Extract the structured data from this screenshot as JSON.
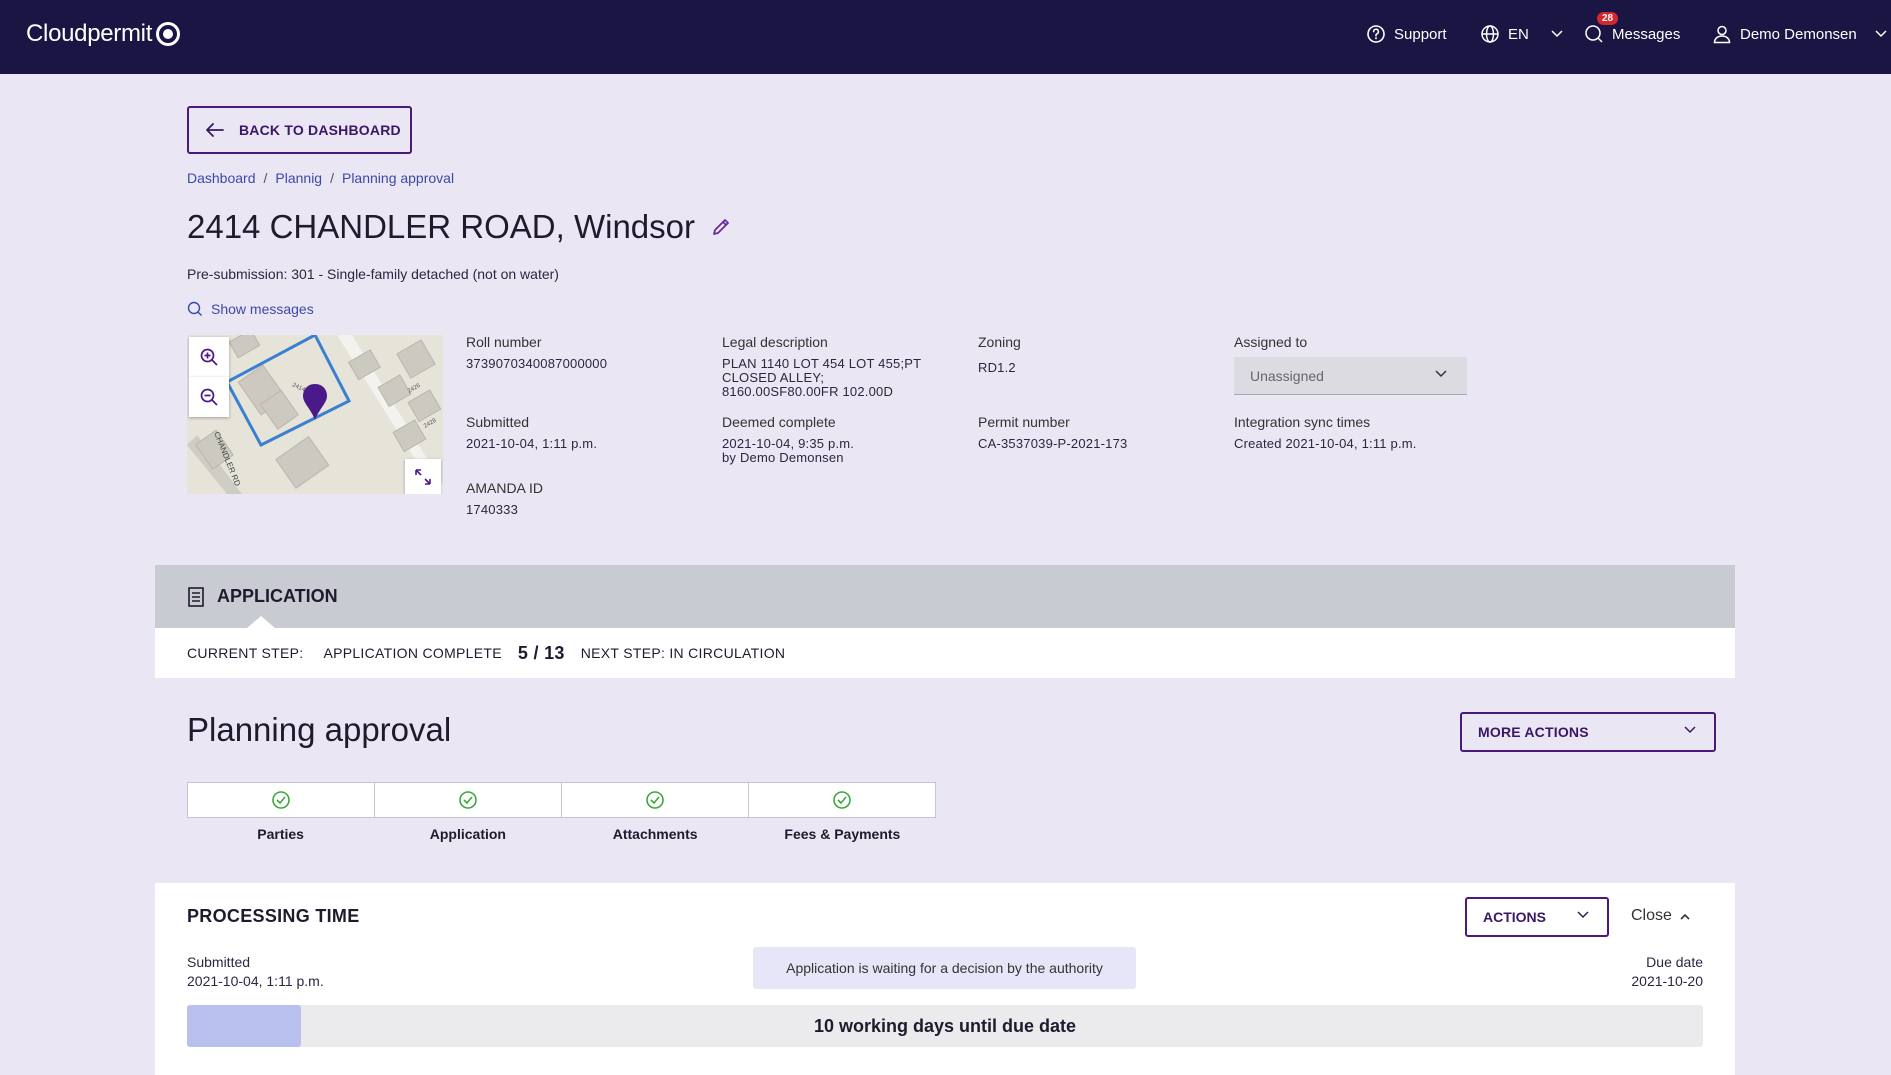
{
  "topbar": {
    "logo_text": "Cloudpermit",
    "support_label": "Support",
    "language_label": "EN",
    "messages_label": "Messages",
    "messages_count": "28",
    "user_name": "Demo Demonsen"
  },
  "back_button": {
    "label": "BACK TO DASHBOARD"
  },
  "breadcrumb": {
    "items": [
      "Dashboard",
      "Plannig",
      "Planning approval"
    ],
    "separator": "/"
  },
  "page": {
    "title": "2414 CHANDLER ROAD, Windsor",
    "subtitle": "Pre-submission: 301 - Single-family detached (not on water)",
    "show_messages": "Show messages"
  },
  "map": {
    "street_label": "CHANDLER RD",
    "house_numbers": [
      "2414",
      "2426",
      "2428"
    ]
  },
  "details": {
    "roll_number": {
      "label": "Roll number",
      "value": "3739070340087000000"
    },
    "legal_description": {
      "label": "Legal description",
      "lines": [
        "PLAN 1140 LOT 454 LOT 455;PT",
        "CLOSED ALLEY;",
        "8160.00SF80.00FR 102.00D"
      ]
    },
    "zoning": {
      "label": "Zoning",
      "value": "RD1.2"
    },
    "assigned_to": {
      "label": "Assigned to",
      "value": "Unassigned"
    },
    "submitted": {
      "label": "Submitted",
      "value": "2021-10-04, 1:11 p.m."
    },
    "deemed_complete": {
      "label": "Deemed complete",
      "value": "2021-10-04, 9:35 p.m.",
      "by": "by Demo Demonsen"
    },
    "permit_number": {
      "label": "Permit number",
      "value": "CA-3537039-P-2021-173"
    },
    "integration_sync": {
      "label": "Integration sync times",
      "value": "Created 2021-10-04, 1:11 p.m."
    },
    "amanda_id": {
      "label": "AMANDA ID",
      "value": "1740333"
    }
  },
  "application": {
    "header": "APPLICATION",
    "current_step_label": "CURRENT STEP:",
    "current_step": "APPLICATION COMPLETE",
    "step_count": "5 / 13",
    "next_step": "NEXT STEP: IN CIRCULATION"
  },
  "section": {
    "title": "Planning approval",
    "more_actions": "MORE ACTIONS",
    "steps": [
      "Parties",
      "Application",
      "Attachments",
      "Fees & Payments"
    ]
  },
  "processing": {
    "title": "PROCESSING TIME",
    "actions_label": "ACTIONS",
    "close_label": "Close",
    "submitted_label": "Submitted",
    "submitted_value": "2021-10-04, 1:11 p.m.",
    "status_message": "Application is waiting for a decision by the authority",
    "due_label": "Due date",
    "due_value": "2021-10-20",
    "progress_fraction": 0.075,
    "progress_text": "10 working days until due date"
  }
}
